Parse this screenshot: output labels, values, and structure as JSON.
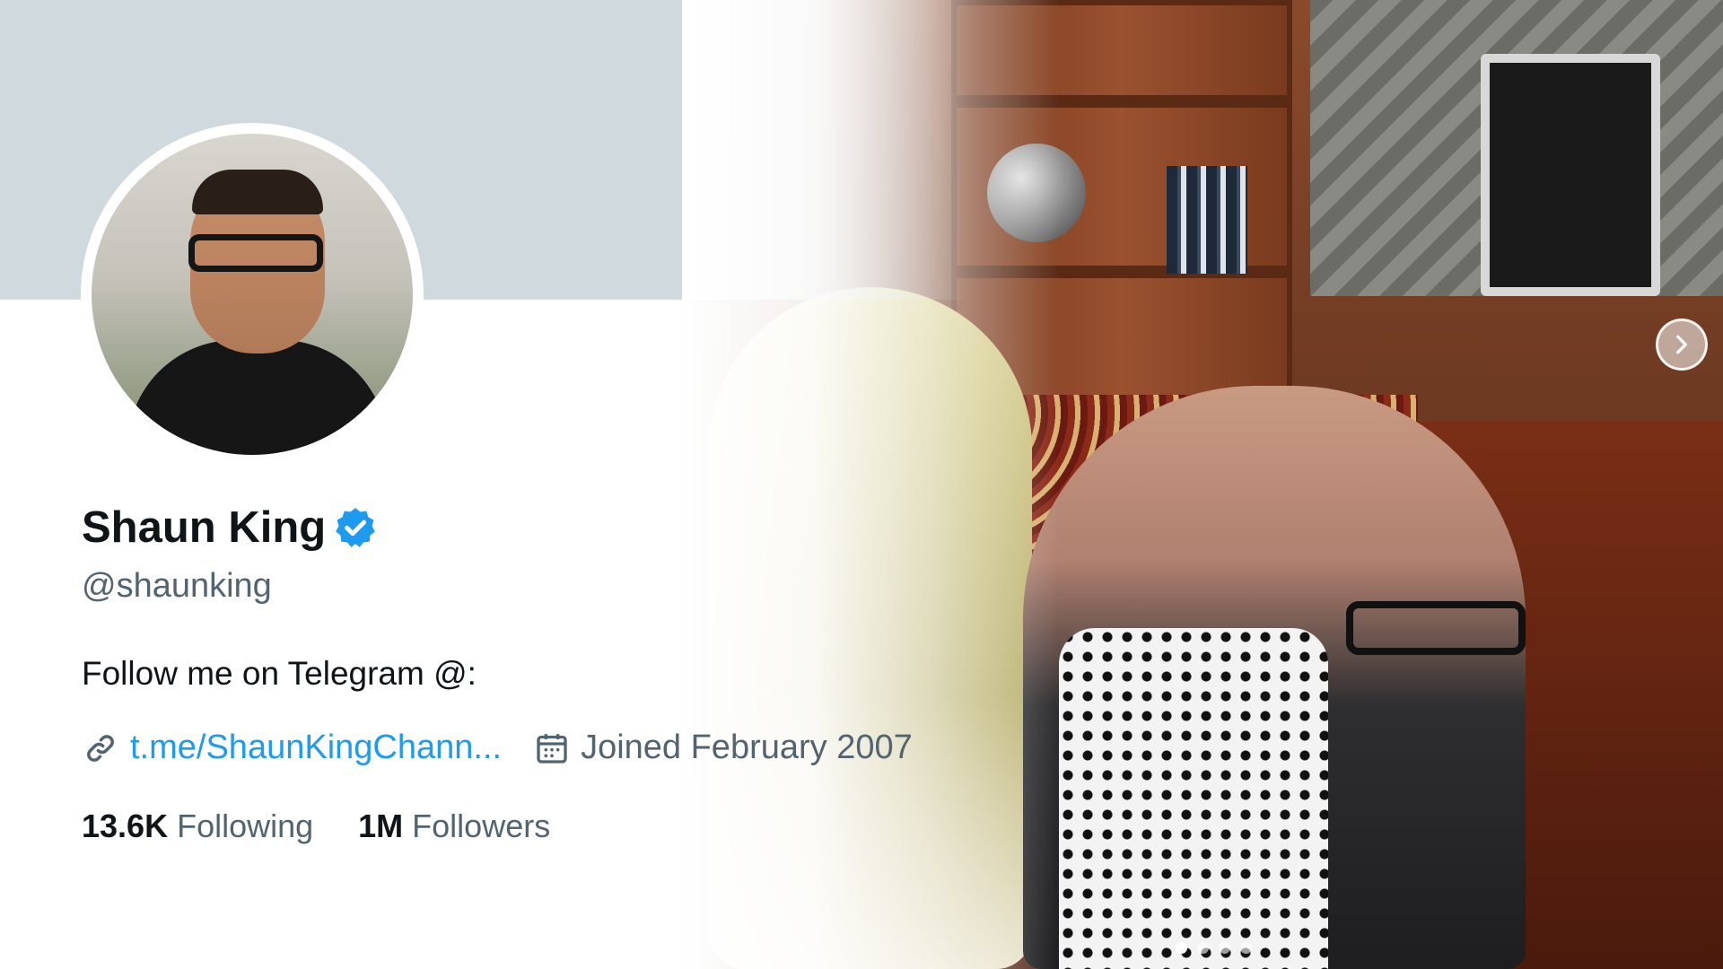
{
  "profile": {
    "name": "Shaun King",
    "handle": "@shaunking",
    "bio": "Follow me on Telegram @:",
    "link": "t.me/ShaunKingChann...",
    "joined": "Joined February 2007",
    "verified": true
  },
  "stats": {
    "following_count": "13.6K",
    "following_label": "Following",
    "followers_count": "1M",
    "followers_label": "Followers"
  },
  "carousel": {
    "slide_count": 4,
    "active_index": 0
  },
  "colors": {
    "accent": "#1d9bf0",
    "banner": "#cfd9de",
    "primary_text": "#0f1419",
    "secondary_text": "#536471"
  },
  "icons": {
    "verified": "verified-badge-icon",
    "link": "link-icon",
    "calendar": "calendar-icon",
    "next": "chevron-right-icon"
  }
}
